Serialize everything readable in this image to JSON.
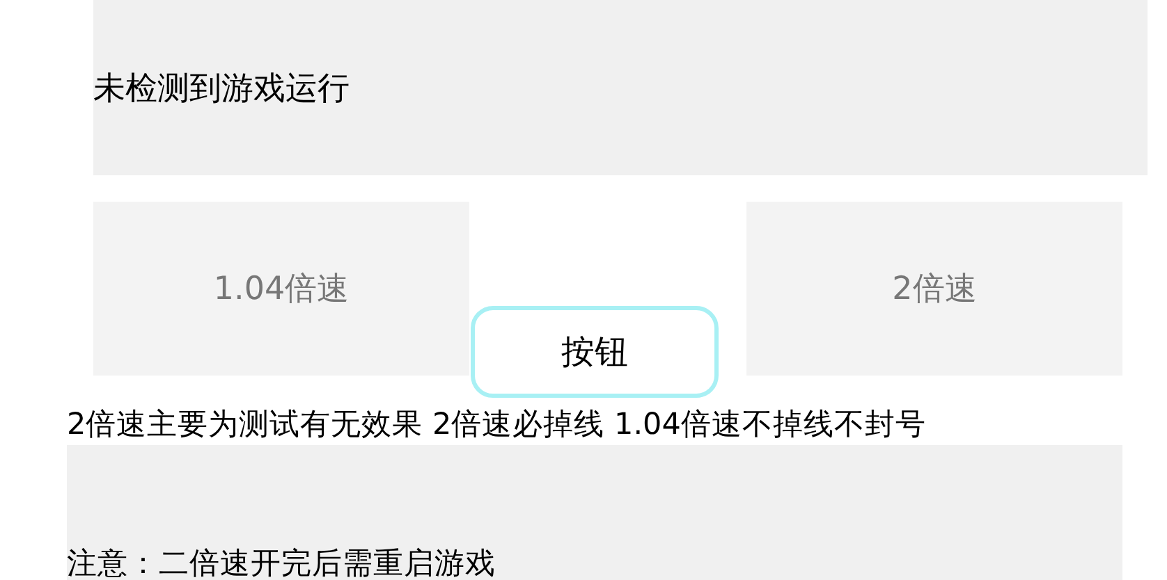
{
  "status": {
    "text": "未检测到游戏运行"
  },
  "speed_buttons": [
    {
      "label": "1.04倍速"
    },
    {
      "label": "2倍速"
    }
  ],
  "center_button": {
    "label": "按钮"
  },
  "info": {
    "text": "2倍速主要为测试有无效果 2倍速必掉线 1.04倍速不掉线不封号"
  },
  "notice": {
    "text": "注意：二倍速开完后需重启游戏"
  }
}
